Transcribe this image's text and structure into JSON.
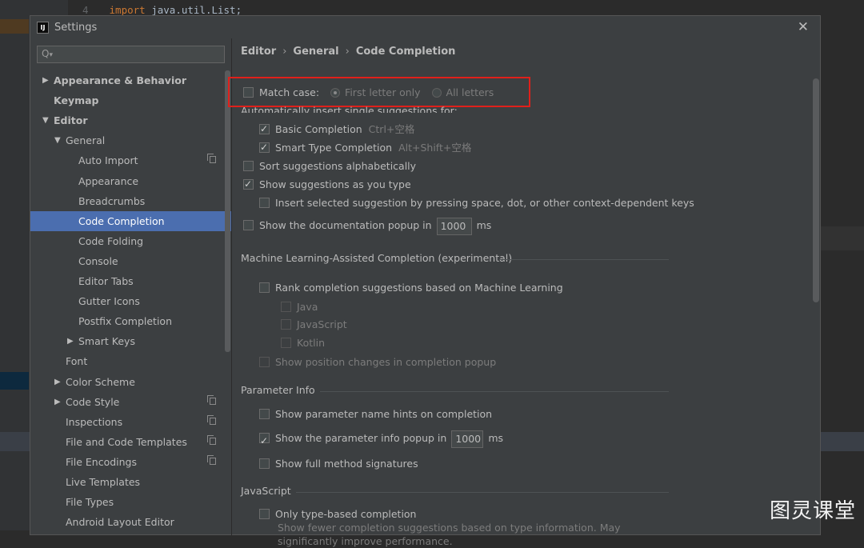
{
  "background_ide": {
    "line_number": "4",
    "code_keyword": "import",
    "code_rest": " java.util.List;"
  },
  "dialog": {
    "title": "Settings",
    "app_icon_text": "IJ",
    "close_icon": "close-icon"
  },
  "search": {
    "placeholder": "",
    "icon": "search-icon"
  },
  "tree": [
    {
      "label": "Appearance & Behavior",
      "level": 0,
      "arrow": "right",
      "bold": true
    },
    {
      "label": "Keymap",
      "level": 0,
      "bold": true
    },
    {
      "label": "Editor",
      "level": 0,
      "arrow": "down",
      "bold": true
    },
    {
      "label": "General",
      "level": 1,
      "arrow": "down"
    },
    {
      "label": "Auto Import",
      "level": 2,
      "copy": true
    },
    {
      "label": "Appearance",
      "level": 2
    },
    {
      "label": "Breadcrumbs",
      "level": 2
    },
    {
      "label": "Code Completion",
      "level": 2,
      "selected": true
    },
    {
      "label": "Code Folding",
      "level": 2
    },
    {
      "label": "Console",
      "level": 2
    },
    {
      "label": "Editor Tabs",
      "level": 2
    },
    {
      "label": "Gutter Icons",
      "level": 2
    },
    {
      "label": "Postfix Completion",
      "level": 2
    },
    {
      "label": "Smart Keys",
      "level": 2,
      "arrow": "right"
    },
    {
      "label": "Font",
      "level": 1
    },
    {
      "label": "Color Scheme",
      "level": 1,
      "arrow": "right"
    },
    {
      "label": "Code Style",
      "level": 1,
      "arrow": "right",
      "copy": true
    },
    {
      "label": "Inspections",
      "level": 1,
      "copy": true
    },
    {
      "label": "File and Code Templates",
      "level": 1,
      "copy": true
    },
    {
      "label": "File Encodings",
      "level": 1,
      "copy": true
    },
    {
      "label": "Live Templates",
      "level": 1
    },
    {
      "label": "File Types",
      "level": 1
    },
    {
      "label": "Android Layout Editor",
      "level": 1
    }
  ],
  "breadcrumb": [
    "Editor",
    "General",
    "Code Completion"
  ],
  "content": {
    "match_case": {
      "label": "Match case:",
      "checked": false,
      "radio_first": "First letter only",
      "radio_all": "All letters",
      "selected": "first"
    },
    "auto_insert_label": "Automatically insert single suggestions for:",
    "basic_completion": {
      "label": "Basic Completion",
      "hint": "Ctrl+空格",
      "checked": true
    },
    "smart_type_completion": {
      "label": "Smart Type Completion",
      "hint": "Alt+Shift+空格",
      "checked": true
    },
    "sort_alpha": {
      "label": "Sort suggestions alphabetically",
      "checked": false
    },
    "show_as_you_type": {
      "label": "Show suggestions as you type",
      "checked": true
    },
    "insert_selected": {
      "label": "Insert selected suggestion by pressing space, dot, or other context-dependent keys",
      "checked": false
    },
    "doc_popup": {
      "label": "Show the documentation popup in",
      "value": "1000",
      "unit": "ms",
      "checked": false
    },
    "ml_section": "Machine Learning-Assisted Completion (experimental)",
    "ml_rank": {
      "label": "Rank completion suggestions based on Machine Learning",
      "checked": false
    },
    "ml_java": "Java",
    "ml_javascript": "JavaScript",
    "ml_kotlin": "Kotlin",
    "ml_position": "Show position changes in completion popup",
    "param_section": "Parameter Info",
    "param_hints": {
      "label": "Show parameter name hints on completion",
      "checked": false
    },
    "param_popup": {
      "label": "Show the parameter info popup in",
      "value": "1000",
      "unit": "ms",
      "checked": true
    },
    "param_full": {
      "label": "Show full method signatures",
      "checked": false
    },
    "js_section": "JavaScript",
    "js_type_based": {
      "label": "Only type-based completion",
      "checked": false
    },
    "js_desc_1": "Show fewer completion suggestions based on type information. May",
    "js_desc_2": "significantly improve performance."
  },
  "watermark": "图灵课堂",
  "colors": {
    "dialog_bg": "#3c3f41",
    "selection": "#4b6eaf",
    "highlight_border": "#e0201b"
  }
}
